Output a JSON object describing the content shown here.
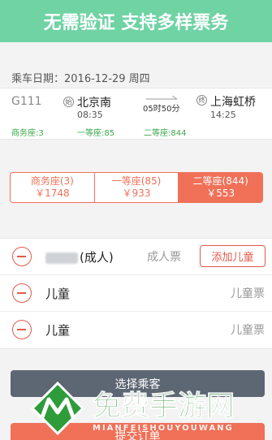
{
  "banner": {
    "text": "无需验证 支持多样票务"
  },
  "trip": {
    "date_label": "乘车日期：2016-12-29 周四"
  },
  "train": {
    "number": "G111",
    "from": {
      "icon": "始",
      "name": "北京南",
      "time": "08:35"
    },
    "to": {
      "icon": "终",
      "name": "上海虹桥",
      "time": "14:25"
    },
    "duration": "05时50分",
    "availability": [
      "商务座:3",
      "一等座:85",
      "二等座:844"
    ]
  },
  "seat_tabs": [
    {
      "name": "商务座(3)",
      "price": "￥1748",
      "active": false
    },
    {
      "name": "一等座(85)",
      "price": "￥933",
      "active": false
    },
    {
      "name": "二等座(844)",
      "price": "￥553",
      "active": true
    }
  ],
  "passengers": {
    "add_child_label": "添加儿童",
    "rows": [
      {
        "name_suffix": "(成人)",
        "ticket_type": "成人票"
      },
      {
        "name": "儿童",
        "ticket_type": "儿童票"
      },
      {
        "name": "儿童",
        "ticket_type": "儿童票"
      }
    ]
  },
  "actions": {
    "select_passenger": "选择乘客",
    "submit_order": "提交订单"
  },
  "watermark": {
    "title": "免费手游网",
    "subtitle": "MIANFEISHOUYOUWANG"
  },
  "colors": {
    "banner": "#6fd3a4",
    "accent": "#f07058",
    "green_text": "#3aa84a",
    "dark_button": "#5d6673"
  }
}
